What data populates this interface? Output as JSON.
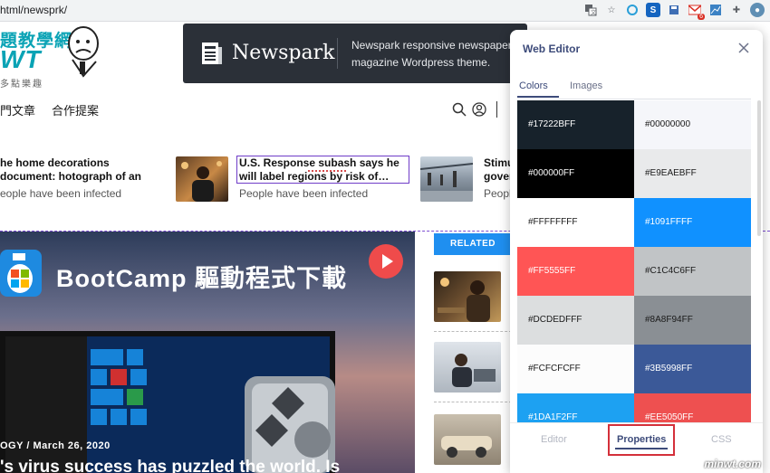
{
  "browser": {
    "url": "html/newsprk/",
    "toolbar_icons": [
      "translate-icon",
      "star-icon",
      "refresh-ext-icon",
      "s-ext-icon",
      "save-ext-icon",
      "gmail-icon",
      "chart-ext-icon",
      "puzzle-icon",
      "profile-avatar"
    ],
    "gmail_badge": "6"
  },
  "site": {
    "logo_line1": "題教學網",
    "logo_line2": "WT",
    "logo_line3": "多點樂趣",
    "banner_name": "Newspark",
    "banner_text": "Newspark responsive newspaper magazine Wordpress theme.",
    "nav": [
      "門文章",
      "合作提案"
    ]
  },
  "ticker": [
    {
      "title": "he home decorations document: hotograph of an",
      "sub": "eople have been infected"
    },
    {
      "title": "U.S. Response subash says he will label regions by risk of…",
      "sub": "People have been infected"
    },
    {
      "title": "Stimu gover",
      "sub": "People"
    }
  ],
  "hero": {
    "title": "BootCamp 驅動程式下載",
    "category": "OGY",
    "date": "March 26, 2020",
    "headline": "'s virus success has puzzled the world. Is"
  },
  "related_label": "RELATED",
  "editor": {
    "title": "Web Editor",
    "tabs": [
      "Colors",
      "Images"
    ],
    "colors": [
      {
        "label": "#17222BFF",
        "color": "#17222B"
      },
      {
        "label": "#00000000",
        "color": "#F5F6FA"
      },
      {
        "label": "#000000FF",
        "color": "#000000"
      },
      {
        "label": "#E9EAEBFF",
        "color": "#E9EAEB"
      },
      {
        "label": "#FFFFFFFF",
        "color": "#FFFFFF"
      },
      {
        "label": "#1091FFFF",
        "color": "#1091FF"
      },
      {
        "label": "#FF5555FF",
        "color": "#FF5555"
      },
      {
        "label": "#C1C4C6FF",
        "color": "#C1C4C6"
      },
      {
        "label": "#DCDEDFFF",
        "color": "#DCDEDF"
      },
      {
        "label": "#8A8F94FF",
        "color": "#8A8F94"
      },
      {
        "label": "#FCFCFCFF",
        "color": "#FCFCFC"
      },
      {
        "label": "#3B5998FF",
        "color": "#3B5998"
      },
      {
        "label": "#1DA1F2FF",
        "color": "#1DA1F2"
      },
      {
        "label": "#EE5050FF",
        "color": "#EE5050"
      }
    ],
    "bottom_tabs": [
      "Editor",
      "Properties",
      "CSS"
    ]
  },
  "watermark": "minwt.com"
}
